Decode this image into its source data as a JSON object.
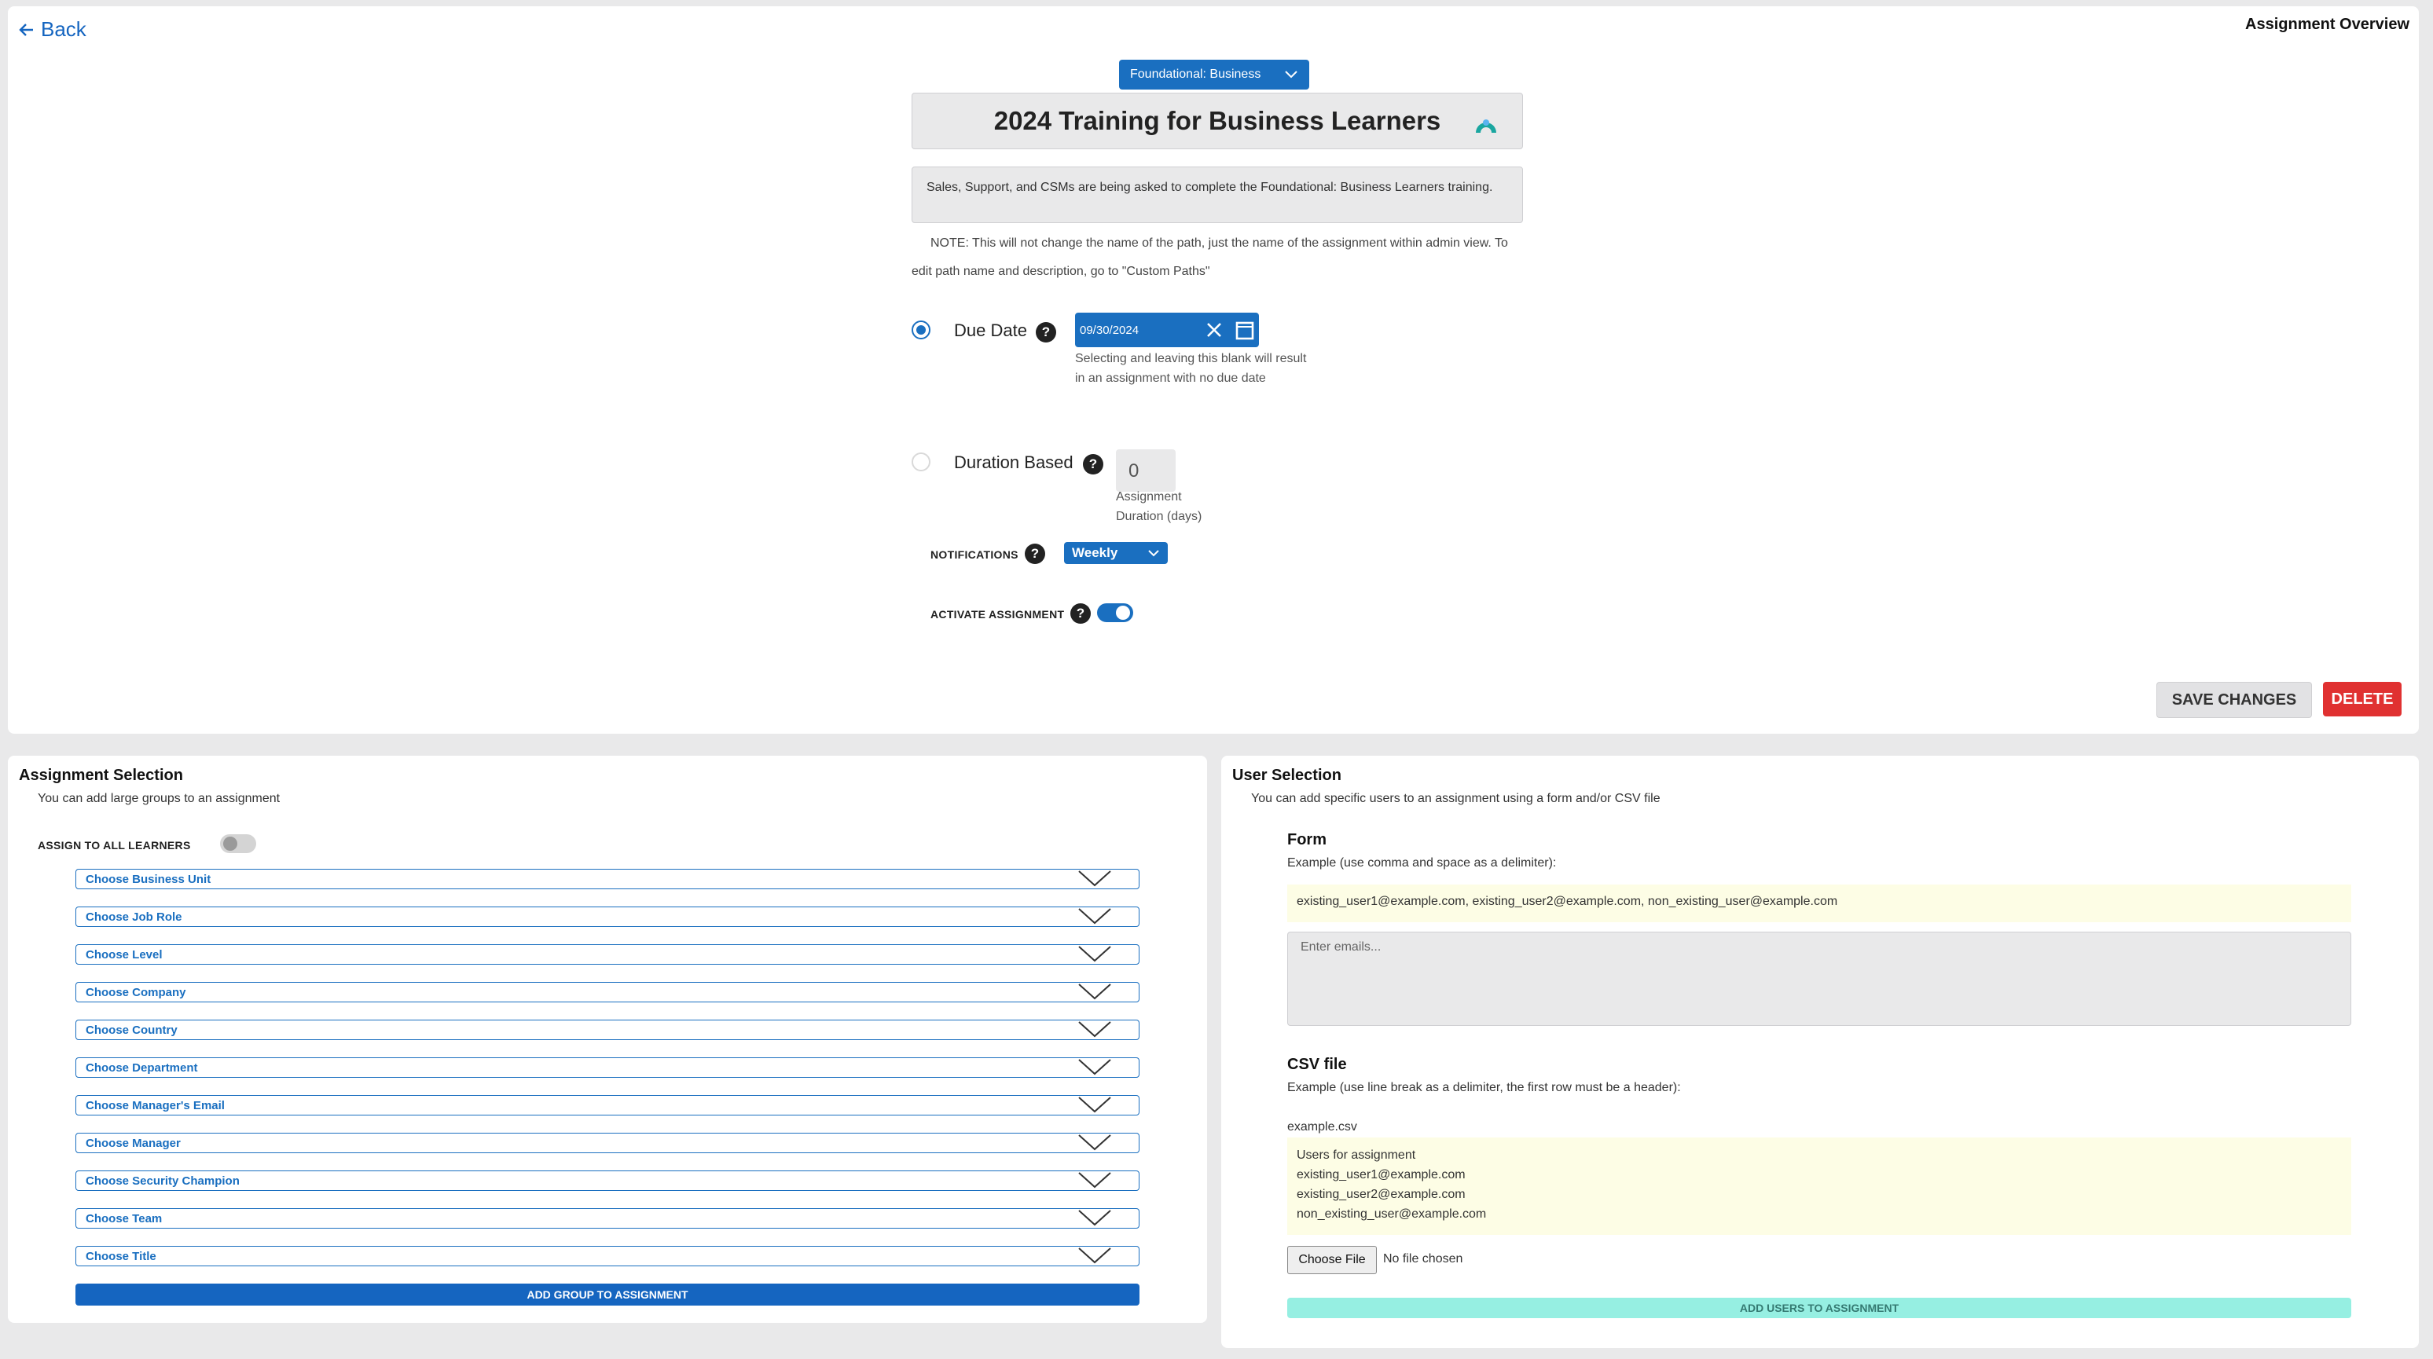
{
  "header": {
    "back_label": "Back",
    "overview_label": "Assignment Overview"
  },
  "path_selector": {
    "value": "Foundational: Business"
  },
  "assignment": {
    "title": "2024 Training for Business Learners",
    "description": "Sales, Support, and CSMs are being asked to complete the Foundational: Business Learners training.",
    "note": "NOTE: This will not change the name of the path, just the name of the assignment within admin view. To edit path name and description, go to \"Custom Paths\""
  },
  "due_date": {
    "label": "Due Date",
    "value": "09/30/2024",
    "help_line1": "Selecting and leaving this blank will result",
    "help_line2": "in an assignment with no due date"
  },
  "duration": {
    "label": "Duration Based",
    "value": "0",
    "caption_line1": "Assignment",
    "caption_line2": "Duration (days)"
  },
  "notifications": {
    "label": "NOTIFICATIONS",
    "value": "Weekly"
  },
  "activate": {
    "label": "ACTIVATE ASSIGNMENT",
    "state": "on"
  },
  "actions": {
    "save_label": "SAVE CHANGES",
    "delete_label": "DELETE"
  },
  "colors": {
    "primary": "#1a6fc0",
    "danger": "#e03131",
    "teal": "#96efe2",
    "highlight": "#fdfde5"
  },
  "assignment_selection": {
    "title": "Assignment Selection",
    "subtitle": "You can add large groups to an assignment",
    "assign_all_label": "ASSIGN TO ALL LEARNERS",
    "choosers": [
      "Choose Business Unit",
      "Choose Job Role",
      "Choose Level",
      "Choose Company",
      "Choose Country",
      "Choose Department",
      "Choose Manager's Email",
      "Choose Manager",
      "Choose Security Champion",
      "Choose Team",
      "Choose Title"
    ],
    "add_group_label": "ADD GROUP TO ASSIGNMENT"
  },
  "user_selection": {
    "title": "User Selection",
    "subtitle": "You can add specific users to an assignment using a form and/or CSV file",
    "form_title": "Form",
    "form_example_label": "Example (use comma and space as a delimiter):",
    "form_example": "existing_user1@example.com, existing_user2@example.com, non_existing_user@example.com",
    "emails_placeholder": "Enter emails...",
    "csv_title": "CSV file",
    "csv_example_label": "Example (use line break as a delimiter, the first row must be a header):",
    "csv_filename": "example.csv",
    "csv_lines": [
      "Users for assignment",
      "existing_user1@example.com",
      "existing_user2@example.com",
      "non_existing_user@example.com"
    ],
    "choose_file_label": "Choose File",
    "no_file_label": "No file chosen",
    "add_users_label": "ADD USERS TO ASSIGNMENT"
  }
}
